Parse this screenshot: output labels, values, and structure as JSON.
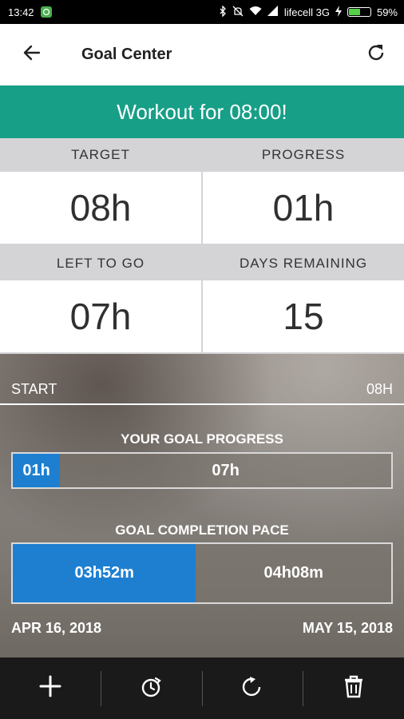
{
  "status_bar": {
    "time": "13:42",
    "carrier": "lifecell 3G",
    "battery_percent": "59%",
    "battery_level": 0.59
  },
  "app_bar": {
    "title": "Goal Center",
    "back_icon": "arrow-left-icon",
    "refresh_icon": "refresh-icon"
  },
  "banner": {
    "text": "Workout for 08:00!"
  },
  "stats": {
    "target": {
      "label": "TARGET",
      "value": "08h"
    },
    "progress": {
      "label": "PROGRESS",
      "value": "01h"
    },
    "left": {
      "label": "LEFT TO GO",
      "value": "07h"
    },
    "days": {
      "label": "DAYS REMAINING",
      "value": "15"
    }
  },
  "timeline": {
    "start_label": "START",
    "end_label": "08H"
  },
  "goal_progress": {
    "title": "YOUR GOAL PROGRESS",
    "done_label": "01h",
    "rest_label": "07h",
    "fraction": 0.125
  },
  "completion_pace": {
    "title": "GOAL COMPLETION PACE",
    "done_label": "03h52m",
    "rest_label": "04h08m",
    "fraction": 0.484
  },
  "dates": {
    "start": "APR 16, 2018",
    "end": "MAY 15, 2018"
  },
  "colors": {
    "accent": "#179f87",
    "progress_blue": "#1e7fd0"
  },
  "bottom_bar": {
    "icons": [
      "plus-icon",
      "timer-icon",
      "reset-icon",
      "trash-icon"
    ]
  }
}
